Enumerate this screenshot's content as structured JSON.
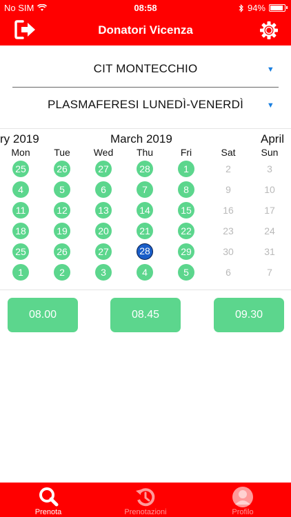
{
  "status_bar": {
    "carrier": "No SIM",
    "time": "08:58",
    "battery": "94%"
  },
  "header": {
    "title": "Donatori Vicenza",
    "logout_icon": "logout-icon",
    "settings_icon": "gear-icon"
  },
  "selectors": {
    "center": "CIT MONTECCHIO",
    "donation_type": "PLASMAFERESI LUNEDÌ-VENERDÌ"
  },
  "calendar": {
    "prev_month_label": "ry 2019",
    "current_month_label": "March 2019",
    "next_month_label": "April",
    "weekdays": [
      "Mon",
      "Tue",
      "Wed",
      "Thu",
      "Fri",
      "Sat",
      "Sun"
    ],
    "weeks": [
      [
        "25",
        "26",
        "27",
        "28",
        "1",
        "2",
        "3"
      ],
      [
        "4",
        "5",
        "6",
        "7",
        "8",
        "9",
        "10"
      ],
      [
        "11",
        "12",
        "13",
        "14",
        "15",
        "16",
        "17"
      ],
      [
        "18",
        "19",
        "20",
        "21",
        "22",
        "23",
        "24"
      ],
      [
        "25",
        "26",
        "27",
        "28",
        "29",
        "30",
        "31"
      ],
      [
        "1",
        "2",
        "3",
        "4",
        "5",
        "6",
        "7"
      ]
    ],
    "selected_week": 4,
    "selected_day": 3,
    "available_color": "#5cd68d",
    "selected_color": "#1a5ec8"
  },
  "time_slots": [
    "08.00",
    "08.45",
    "09.30"
  ],
  "tab_bar": {
    "tabs": [
      {
        "label": "Prenota",
        "icon": "search-icon"
      },
      {
        "label": "Prenotazioni",
        "icon": "history-icon"
      },
      {
        "label": "Profilo",
        "icon": "profile-icon"
      }
    ]
  },
  "colors": {
    "brand": "#ff0000",
    "accent_blue": "#1a7fe0"
  }
}
